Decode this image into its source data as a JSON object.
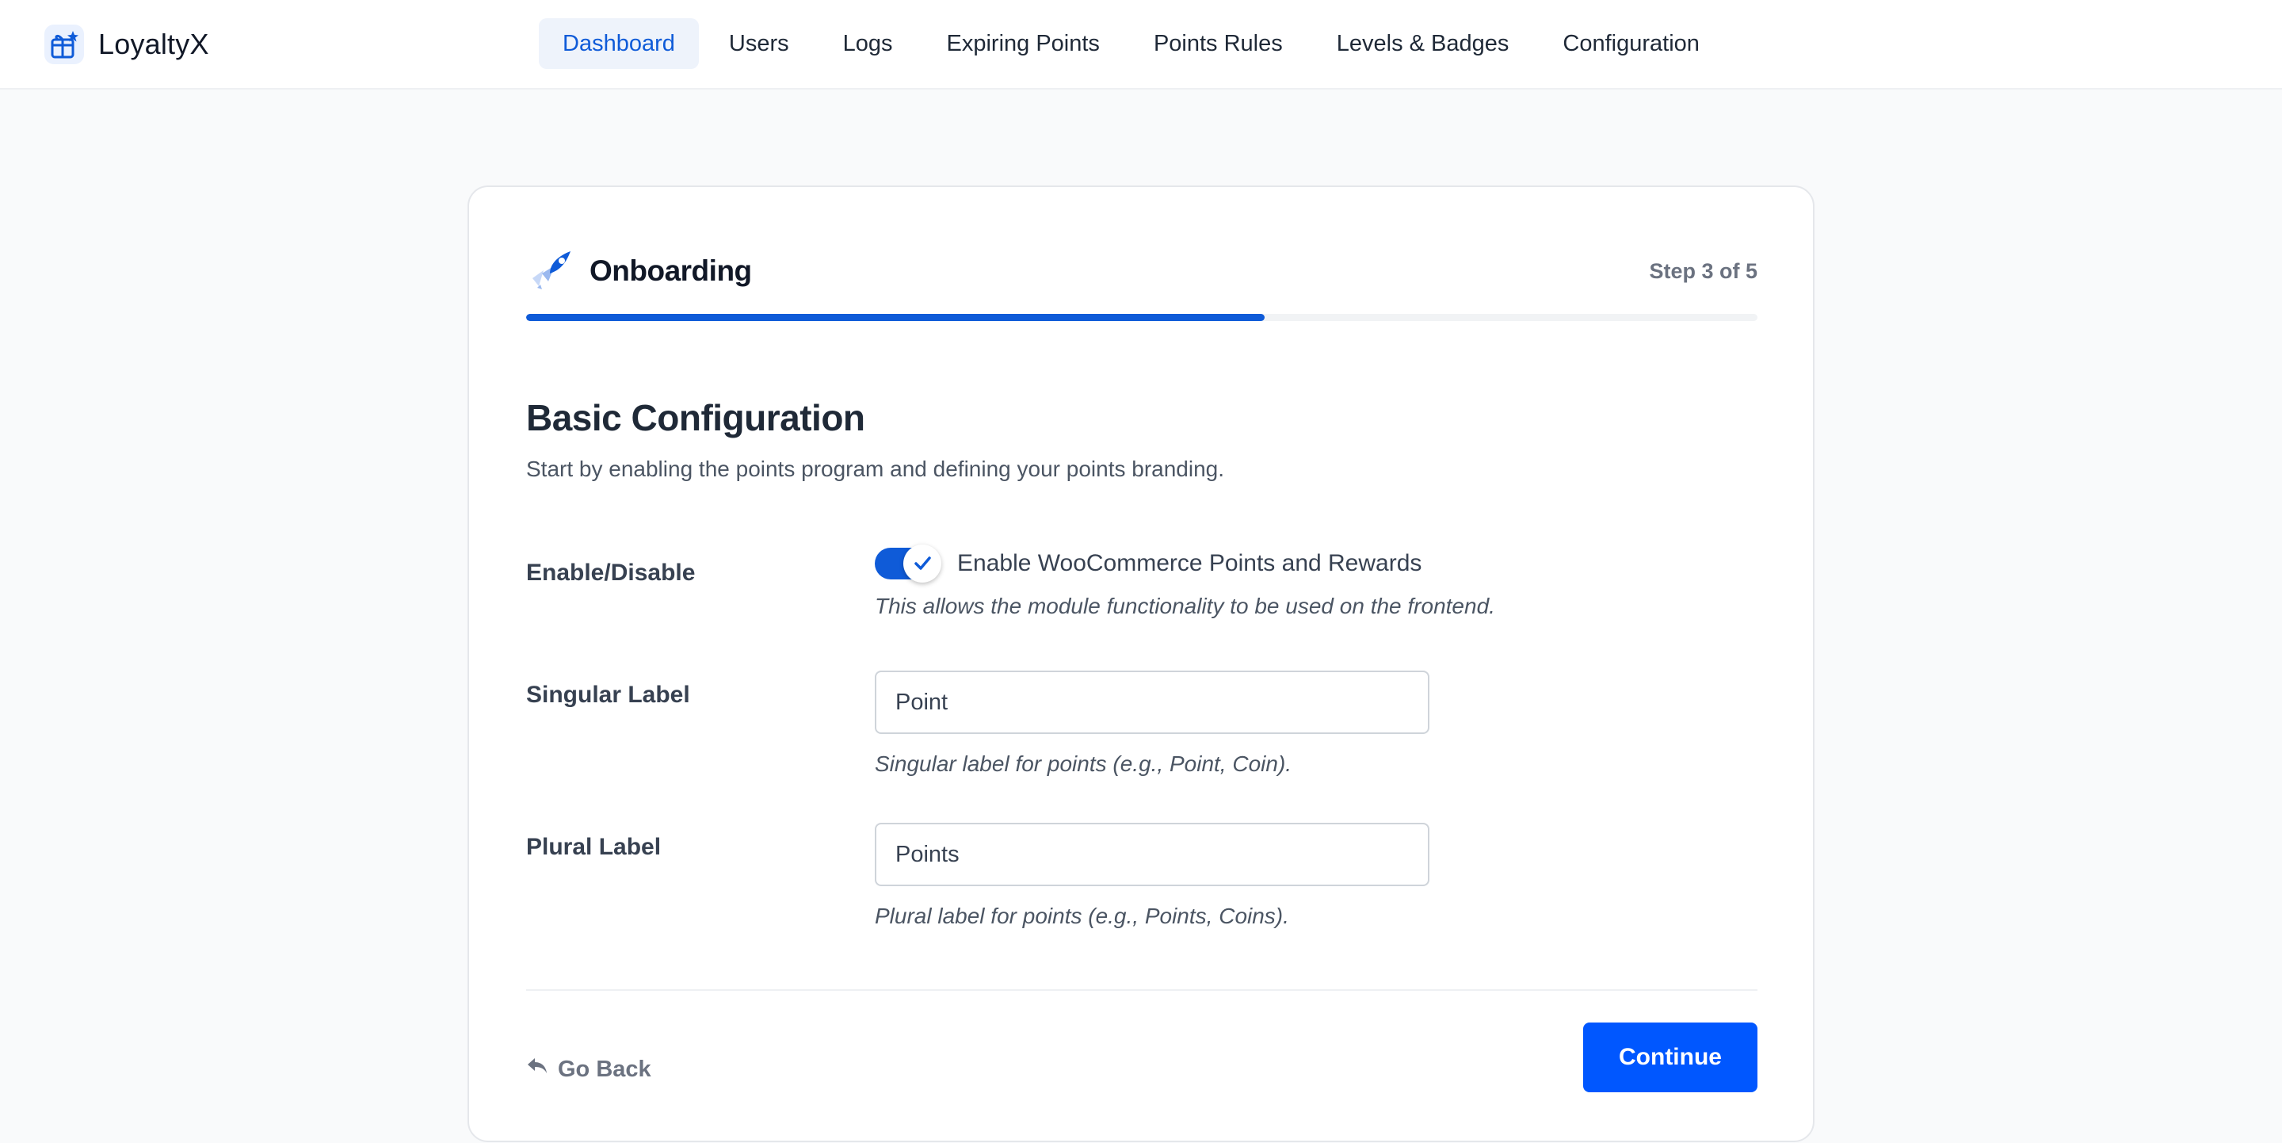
{
  "app": {
    "name": "LoyaltyX",
    "icon": "gift-icon",
    "accent_color": "#0f5bd8"
  },
  "nav": {
    "items": [
      {
        "label": "Dashboard",
        "active": true
      },
      {
        "label": "Users",
        "active": false
      },
      {
        "label": "Logs",
        "active": false
      },
      {
        "label": "Expiring Points",
        "active": false
      },
      {
        "label": "Points Rules",
        "active": false
      },
      {
        "label": "Levels & Badges",
        "active": false
      },
      {
        "label": "Configuration",
        "active": false
      }
    ]
  },
  "onboarding": {
    "title": "Onboarding",
    "icon": "rocket-icon",
    "step_text": "Step 3 of 5",
    "progress_fraction": 0.6
  },
  "section": {
    "title": "Basic Configuration",
    "description": "Start by enabling the points program and defining your points branding."
  },
  "fields": {
    "enable": {
      "label": "Enable/Disable",
      "toggle_on": true,
      "toggle_text": "Enable WooCommerce Points and Rewards",
      "help": "This allows the module functionality to be used on the frontend."
    },
    "singular": {
      "label": "Singular Label",
      "value": "Point",
      "help": "Singular label for points (e.g., Point, Coin)."
    },
    "plural": {
      "label": "Plural Label",
      "value": "Points",
      "help": "Plural label for points (e.g., Points, Coins)."
    }
  },
  "footer": {
    "back_label": "Go Back",
    "back_icon": "reply-arrow-icon",
    "continue_label": "Continue",
    "continue_color": "#0057ff"
  }
}
